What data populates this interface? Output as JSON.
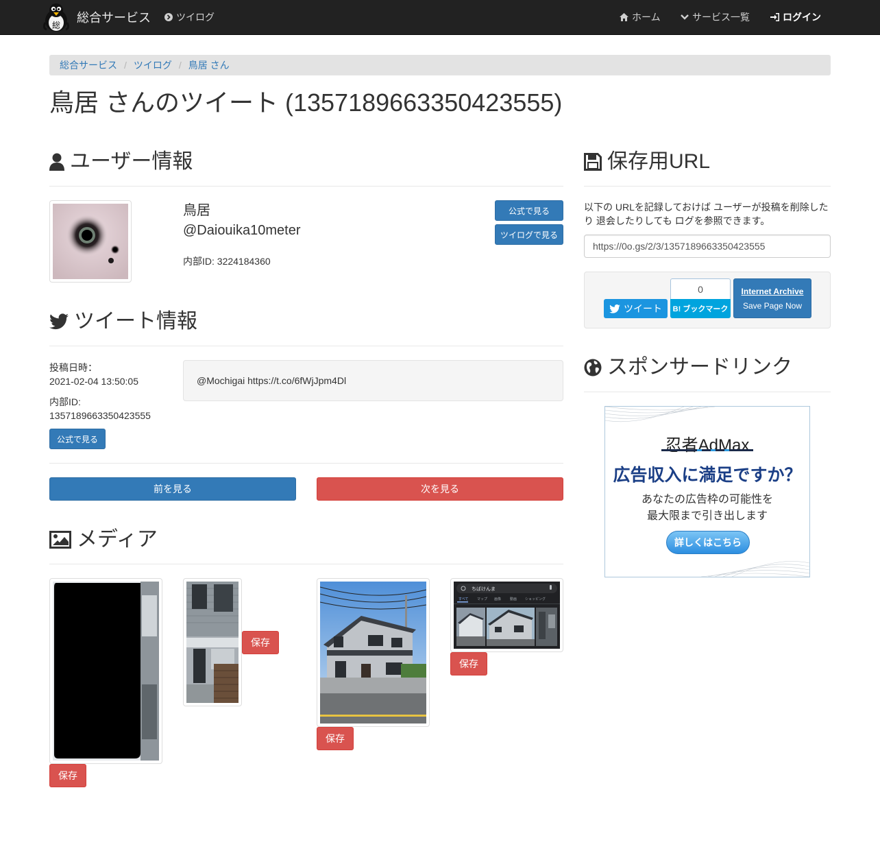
{
  "nav": {
    "brand": "総合サービス",
    "twilog": "ツイログ",
    "home": "ホーム",
    "services": "サービス一覧",
    "login": "ログイン"
  },
  "breadcrumb": [
    "総合サービス",
    "ツイログ",
    "鳥居 さん"
  ],
  "page_title": "鳥居 さんのツイート (1357189663350423555)",
  "user_section": {
    "heading": "ユーザー情報",
    "name": "鳥居",
    "handle": "@Daiouika10meter",
    "internal_id": "内部ID: 3224184360",
    "official_button": "公式で見る",
    "twilog_button": "ツイログで見る"
  },
  "tweet_section": {
    "heading": "ツイート情報",
    "posted_label": "投稿日時：",
    "posted_value": "2021-02-04 13:50:05",
    "id_label": "内部ID:",
    "id_value": "1357189663350423555",
    "official_button": "公式で見る",
    "text": "@Mochigai https://t.co/6fWjJpm4Dl"
  },
  "pager": {
    "prev": "前を見る",
    "next": "次を見る"
  },
  "media_section": {
    "heading": "メディア",
    "save_button": "保存"
  },
  "archive_section": {
    "heading": "保存用URL",
    "note": "以下の URLを記録しておけば ユーザーが投稿を削除したり 退会したりしても ログを参照できます。",
    "url": "https://0o.gs/2/3/1357189663350423555",
    "tweet_button": "ツイート",
    "hatena_count": "0",
    "hatena_button": "B! ブックマーク",
    "ia_title": "Internet Archive",
    "ia_sub": "Save Page Now"
  },
  "sponsor_section": {
    "heading": "スポンサードリンク",
    "ad_brand": "忍者AdMax",
    "ad_headline": "広告収入に満足ですか？",
    "ad_line1": "あなたの広告枠の可能性を",
    "ad_line2": "最大限まで引き出します",
    "ad_cta": "詳しくはこちら"
  },
  "thumb4": {
    "search_text": "ちばけんま",
    "tabs": [
      "すべて",
      "マップ",
      "画像",
      "動画",
      "ショッピング"
    ]
  },
  "colors": {
    "primary": "#337ab7",
    "danger": "#d9534f",
    "navbar": "#222222",
    "twitter": "#1b95e0",
    "hatena": "#00a4de"
  }
}
